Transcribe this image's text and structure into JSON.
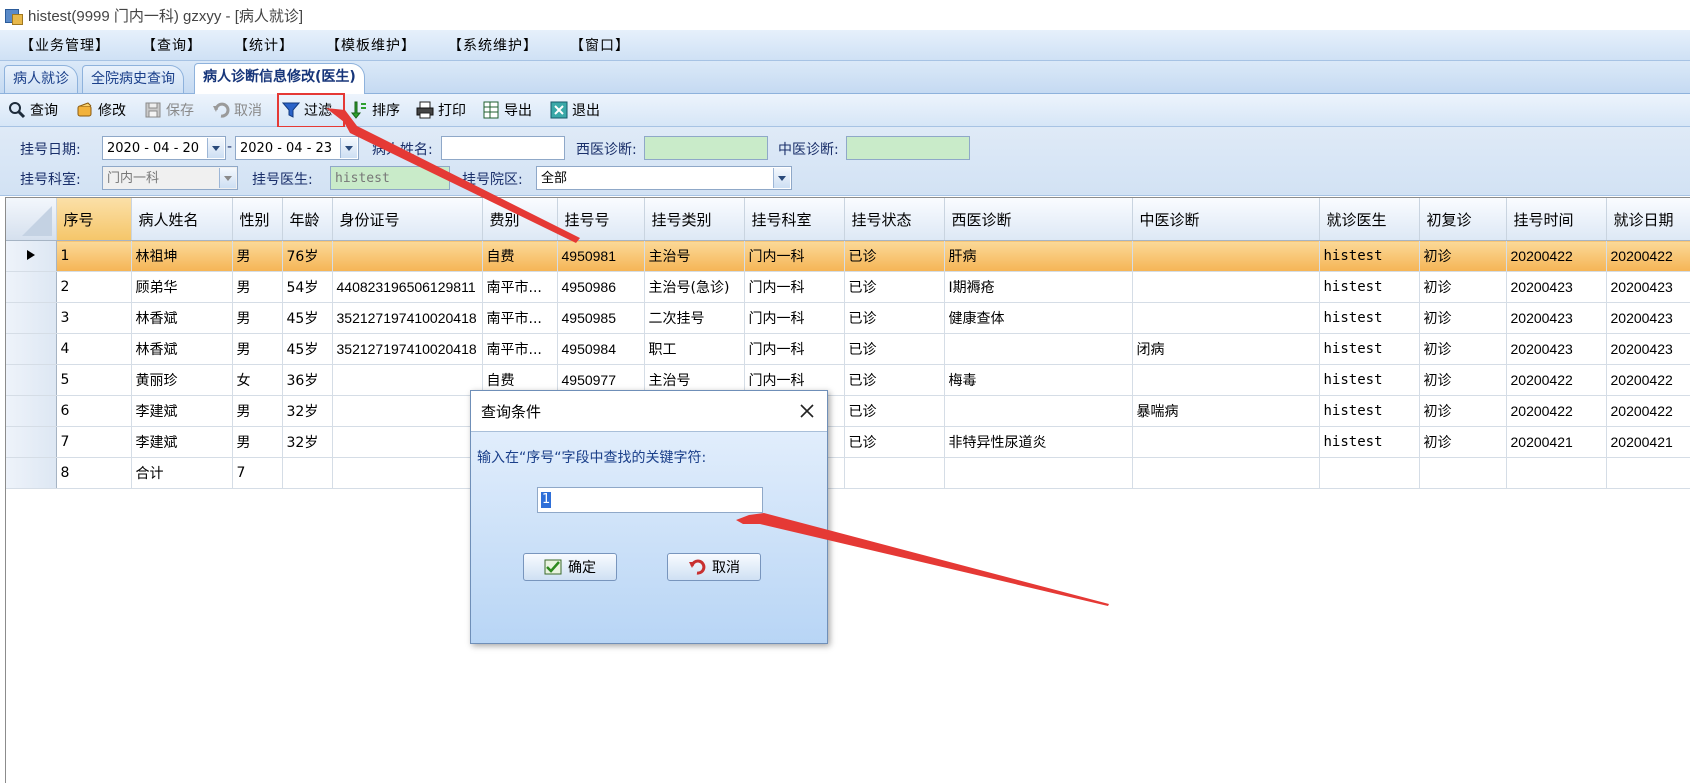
{
  "window": {
    "title": "histest(9999 门内一科) gzxyy - [病人就诊]"
  },
  "menu": [
    "【业务管理】",
    "【查询】",
    "【统计】",
    "【模板维护】",
    "【系统维护】",
    "【窗口】"
  ],
  "tabs": [
    {
      "label": "病人就诊",
      "active": false
    },
    {
      "label": "全院病史查询",
      "active": false
    },
    {
      "label": "病人诊断信息修改(医生)",
      "active": true
    }
  ],
  "toolbar": {
    "query": "查询",
    "edit": "修改",
    "save": "保存",
    "cancel": "取消",
    "filter": "过滤",
    "sort": "排序",
    "print": "打印",
    "export": "导出",
    "exit": "退出"
  },
  "filters": {
    "reg_date_label": "挂号日期:",
    "date_from": "2020 - 04 - 20",
    "date_sep": "-",
    "date_to": "2020 - 04 - 23",
    "patient_name_label": "病人姓名:",
    "patient_name_value": "",
    "western_dx_label": "西医诊断:",
    "western_dx_value": "",
    "chinese_dx_label": "中医诊断:",
    "chinese_dx_value": "",
    "dept_label": "挂号科室:",
    "dept_value": "门内一科",
    "doctor_label": "挂号医生:",
    "doctor_value": "histest",
    "campus_label": "挂号院区:",
    "campus_value": "全部"
  },
  "table": {
    "columns": [
      "序号",
      "病人姓名",
      "性别",
      "年龄",
      "身份证号",
      "费别",
      "挂号号",
      "挂号类别",
      "挂号科室",
      "挂号状态",
      "西医诊断",
      "中医诊断",
      "就诊医生",
      "初复诊",
      "挂号时间",
      "就诊日期"
    ],
    "rows": [
      [
        "1",
        "林祖坤",
        "男",
        "76岁",
        "",
        "自费",
        "4950981",
        "主治号",
        "门内一科",
        "已诊",
        "肝病",
        "",
        "histest",
        "初诊",
        "20200422",
        "20200422"
      ],
      [
        "2",
        "顾弟华",
        "男",
        "54岁",
        "440823196506129811",
        "南平市...",
        "4950986",
        "主治号(急诊)",
        "门内一科",
        "已诊",
        "Ⅰ期褥疮",
        "",
        "histest",
        "初诊",
        "20200423",
        "20200423"
      ],
      [
        "3",
        "林香斌",
        "男",
        "45岁",
        "352127197410020418",
        "南平市...",
        "4950985",
        "二次挂号",
        "门内一科",
        "已诊",
        "健康查体",
        "",
        "histest",
        "初诊",
        "20200423",
        "20200423"
      ],
      [
        "4",
        "林香斌",
        "男",
        "45岁",
        "352127197410020418",
        "南平市...",
        "4950984",
        "职工",
        "门内一科",
        "已诊",
        "",
        "闭病",
        "histest",
        "初诊",
        "20200423",
        "20200423"
      ],
      [
        "5",
        "黄丽珍",
        "女",
        "36岁",
        "",
        "自费",
        "4950977",
        "主治号",
        "门内一科",
        "已诊",
        "梅毒",
        "",
        "histest",
        "初诊",
        "20200422",
        "20200422"
      ],
      [
        "6",
        "李建斌",
        "男",
        "32岁",
        "",
        "",
        "",
        "",
        "",
        "已诊",
        "",
        "暴喘病",
        "histest",
        "初诊",
        "20200422",
        "20200422"
      ],
      [
        "7",
        "李建斌",
        "男",
        "32岁",
        "",
        "",
        "",
        "",
        "",
        "已诊",
        "非特异性尿道炎",
        "",
        "histest",
        "初诊",
        "20200421",
        "20200421"
      ],
      [
        "8",
        "合计",
        "7",
        "",
        "",
        "",
        "",
        "",
        "",
        "",
        "",
        "",
        "",
        "",
        "",
        ""
      ]
    ]
  },
  "dialog": {
    "title": "查询条件",
    "prompt": "输入在“序号“字段中查找的关键字符:",
    "input_value": "1",
    "ok_label": "确定",
    "cancel_label": "取消"
  },
  "colors": {
    "selection_row": "#f5b455",
    "annotation_red": "#e53935",
    "menu_bg": "#cfe1f5",
    "field_green": "#c9ebc9"
  }
}
